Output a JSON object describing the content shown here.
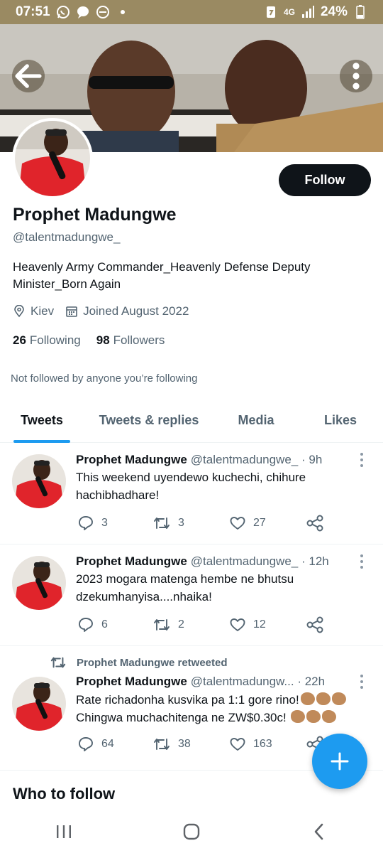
{
  "status_bar": {
    "time": "07:51",
    "network": "4G",
    "battery": "24%",
    "left_icons": [
      "whatsapp-icon",
      "chat-bubble-icon",
      "do-not-disturb-icon",
      "dot-icon"
    ],
    "right_icons": [
      "battery-saver-icon",
      "signal-icon",
      "battery-icon"
    ]
  },
  "header": {
    "back_icon": "arrow-left-icon",
    "more_icon": "more-vertical-icon"
  },
  "profile": {
    "name": "Prophet Madungwe",
    "handle": "@talentmadungwe_",
    "bio": "Heavenly Army Commander_Heavenly Defense Deputy Minister_Born Again",
    "location": "Kiev",
    "joined": "Joined August 2022",
    "following_count": "26",
    "following_label": "Following",
    "followers_count": "98",
    "followers_label": "Followers",
    "not_followed": "Not followed by anyone you’re following",
    "follow_button": "Follow"
  },
  "tabs": [
    {
      "label": "Tweets",
      "active": true
    },
    {
      "label": "Tweets & replies",
      "active": false
    },
    {
      "label": "Media",
      "active": false
    },
    {
      "label": "Likes",
      "active": false
    }
  ],
  "tweets": [
    {
      "name": "Prophet Madungwe",
      "handle": "@talentmadungwe_",
      "time": "· 9h",
      "text": "This weekend uyendewo kuchechi, chihure hachibhadhare!",
      "replies": "3",
      "retweets": "3",
      "likes": "27"
    },
    {
      "name": "Prophet Madungwe",
      "handle": "@talentmadungwe_",
      "time": "· 12h",
      "text": "2023 mogara matenga hembe ne bhutsu dzekumhanyisa....nhaika!",
      "replies": "6",
      "retweets": "2",
      "likes": "12"
    },
    {
      "retweet_context": "Prophet Madungwe retweeted",
      "name": "Prophet Madungwe",
      "handle": "@talentmadungw...",
      "time": "· 22h",
      "text_line1": "Rate richadonha kusvika pa 1:1 gore rino!",
      "text_line2": "Chingwa muchachitenga ne ZW$0.30c!",
      "emoji": "clapping-hands-medium-dark-skin-tone",
      "replies": "64",
      "retweets": "38",
      "likes": "163"
    }
  ],
  "who_to_follow": "Who to follow",
  "fab_icon": "plus-icon",
  "colors": {
    "accent": "#1d9bf0",
    "text": "#0f1419",
    "secondary": "#536471",
    "status_bar": "#9a8a62"
  }
}
